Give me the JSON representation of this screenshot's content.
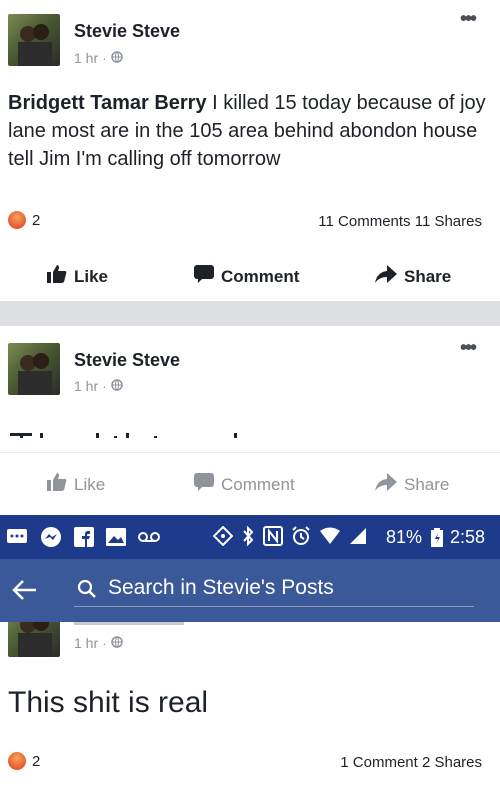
{
  "post1": {
    "author": "Stevie Steve",
    "time": "1 hr",
    "tagged": "Bridgett Tamar Berry",
    "text": " I killed 15 today because of joy lane most are in the 105 area behind abondon house tell Jim I'm calling off tomorrow",
    "reaction_count": "2",
    "stats": "11 Comments 11 Shares",
    "actions": {
      "like": "Like",
      "comment": "Comment",
      "share": "Share"
    }
  },
  "post2": {
    "author": "Stevie Steve",
    "time": "1 hr",
    "actions": {
      "like": "Like",
      "comment": "Comment",
      "share": "Share"
    }
  },
  "statusbar": {
    "battery": "81%",
    "clock": "2:58"
  },
  "search": {
    "placeholder": "Search in Stevie's Posts"
  },
  "post3": {
    "time": "1 hr",
    "text": "This shit is real",
    "reaction_count": "2",
    "stats": "1 Comment 2 Shares"
  },
  "colors": {
    "status_bar": "#1e3a8a",
    "search_bar": "#3b5998",
    "divider": "#dddfe2",
    "meta_text": "#90949c"
  },
  "icons": [
    "globe-icon",
    "more-icon",
    "angry-reaction-icon",
    "like-icon",
    "comment-icon",
    "share-icon",
    "back-arrow-icon",
    "search-icon"
  ]
}
